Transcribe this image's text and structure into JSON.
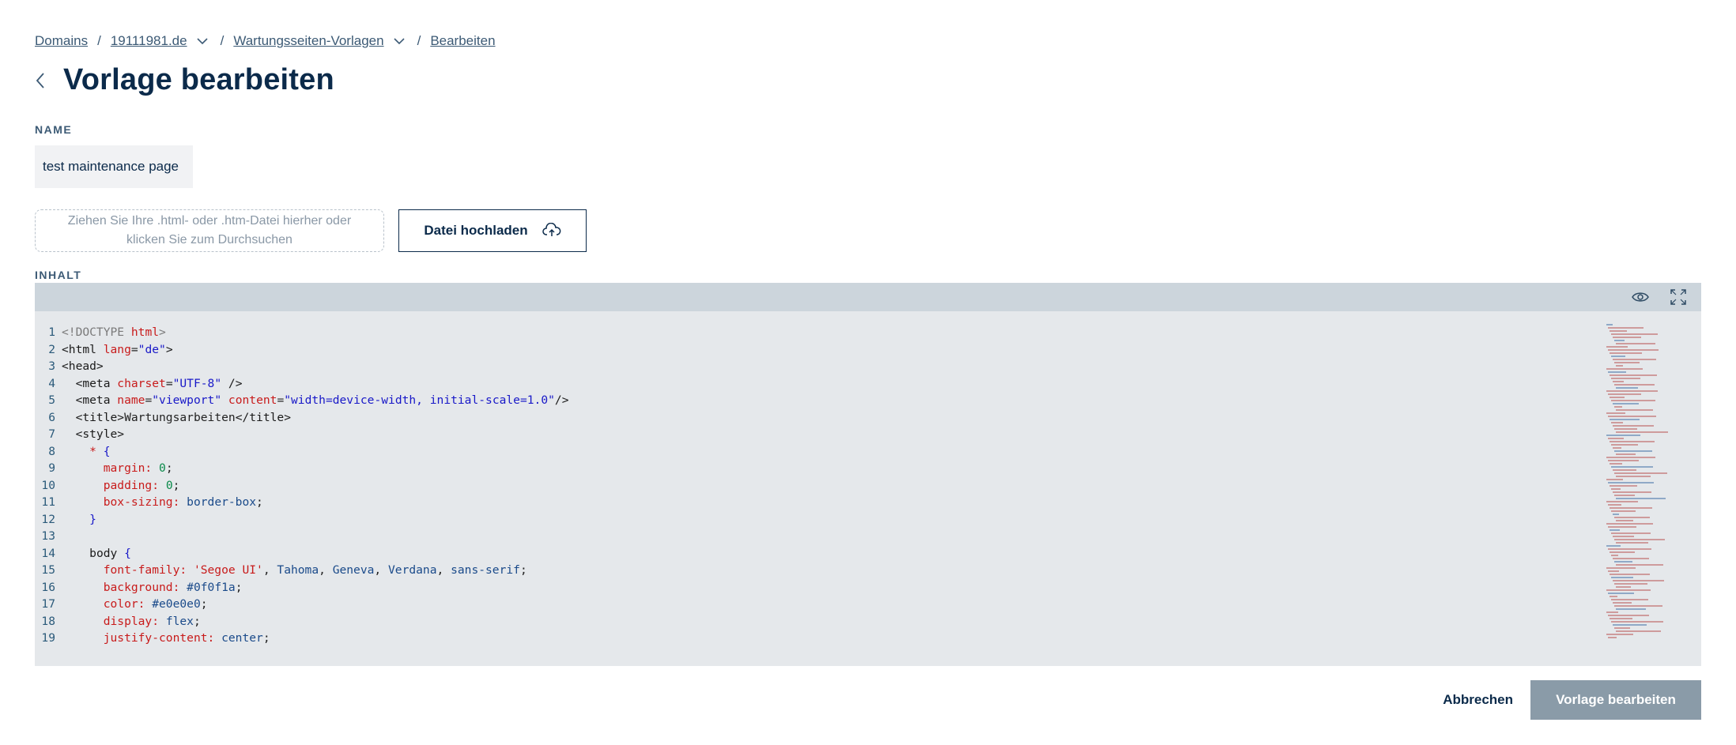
{
  "breadcrumb": {
    "items": [
      "Domains",
      "19111981.de",
      "Wartungsseiten-Vorlagen",
      "Bearbeiten"
    ],
    "separator": "/"
  },
  "page": {
    "title": "Vorlage bearbeiten"
  },
  "form": {
    "name_label": "NAME",
    "name_value": "test maintenance page",
    "dropzone_text_1": "Ziehen Sie Ihre .html- oder .htm-Datei hierher oder",
    "dropzone_text_2": "klicken Sie zum Durchsuchen",
    "upload_label": "Datei hochladen",
    "content_label": "INHALT"
  },
  "editor": {
    "icons": [
      "eye-icon",
      "fullscreen-icon"
    ],
    "lines": [
      {
        "n": "1",
        "html": "<span class=\"tk-doc\">&lt;!DOCTYPE </span><span class=\"tk-name\">html</span><span class=\"tk-doc\">&gt;</span>"
      },
      {
        "n": "2",
        "html": "<span class=\"tk-tag\">&lt;html </span><span class=\"tk-attr\">lang</span>=<span class=\"tk-str\">\"de\"</span><span class=\"tk-tag\">&gt;</span>"
      },
      {
        "n": "3",
        "html": "<span class=\"tk-tag\">&lt;head&gt;</span>"
      },
      {
        "n": "4",
        "html": "  <span class=\"tk-tag\">&lt;meta </span><span class=\"tk-attr\">charset</span>=<span class=\"tk-str\">\"UTF-8\"</span><span class=\"tk-tag\"> /&gt;</span>"
      },
      {
        "n": "5",
        "html": "  <span class=\"tk-tag\">&lt;meta </span><span class=\"tk-attr\">name</span>=<span class=\"tk-str\">\"viewport\"</span> <span class=\"tk-attr\">content</span>=<span class=\"tk-str\">\"width=device-width, initial-scale=1.0\"</span><span class=\"tk-tag\">/&gt;</span>"
      },
      {
        "n": "6",
        "html": "  <span class=\"tk-tag\">&lt;title&gt;</span>Wartungsarbeiten<span class=\"tk-tag\">&lt;/title&gt;</span>"
      },
      {
        "n": "7",
        "html": "  <span class=\"tk-tag\">&lt;style&gt;</span>"
      },
      {
        "n": "8",
        "html": "    <span class=\"tk-sel\">*</span> <span class=\"tk-brace\">{</span>"
      },
      {
        "n": "9",
        "html": "      <span class=\"tk-prop\">margin:</span> <span class=\"tk-num\">0</span>;"
      },
      {
        "n": "10",
        "html": "      <span class=\"tk-prop\">padding:</span> <span class=\"tk-num\">0</span>;"
      },
      {
        "n": "11",
        "html": "      <span class=\"tk-prop\">box-sizing:</span> <span class=\"tk-val\">border-box</span>;"
      },
      {
        "n": "12",
        "html": "    <span class=\"tk-brace\">}</span>"
      },
      {
        "n": "13",
        "html": ""
      },
      {
        "n": "14",
        "html": "    <span class=\"tk-tag\">body</span> <span class=\"tk-brace\">{</span>"
      },
      {
        "n": "15",
        "html": "      <span class=\"tk-prop\">font-family:</span> <span class=\"tk-sel\">'Segoe UI'</span>, <span class=\"tk-val\">Tahoma</span>, <span class=\"tk-val\">Geneva</span>, <span class=\"tk-val\">Verdana</span>, <span class=\"tk-val\">sans-serif</span>;"
      },
      {
        "n": "16",
        "html": "      <span class=\"tk-prop\">background:</span> <span class=\"tk-val\">#0f0f1a</span>;"
      },
      {
        "n": "17",
        "html": "      <span class=\"tk-prop\">color:</span> <span class=\"tk-val\">#e0e0e0</span>;"
      },
      {
        "n": "18",
        "html": "      <span class=\"tk-prop\">display:</span> <span class=\"tk-val\">flex</span>;"
      },
      {
        "n": "19",
        "html": "      <span class=\"tk-prop\">justify-content:</span> <span class=\"tk-val\">center</span>;"
      }
    ]
  },
  "actions": {
    "cancel_label": "Abbrechen",
    "submit_label": "Vorlage bearbeiten"
  },
  "colors": {
    "primary": "#0b2a4a",
    "submit_disabled": "#8a9ba8",
    "editor_bg": "#e5e8eb",
    "toolbar_bg": "#ccd5dc"
  }
}
